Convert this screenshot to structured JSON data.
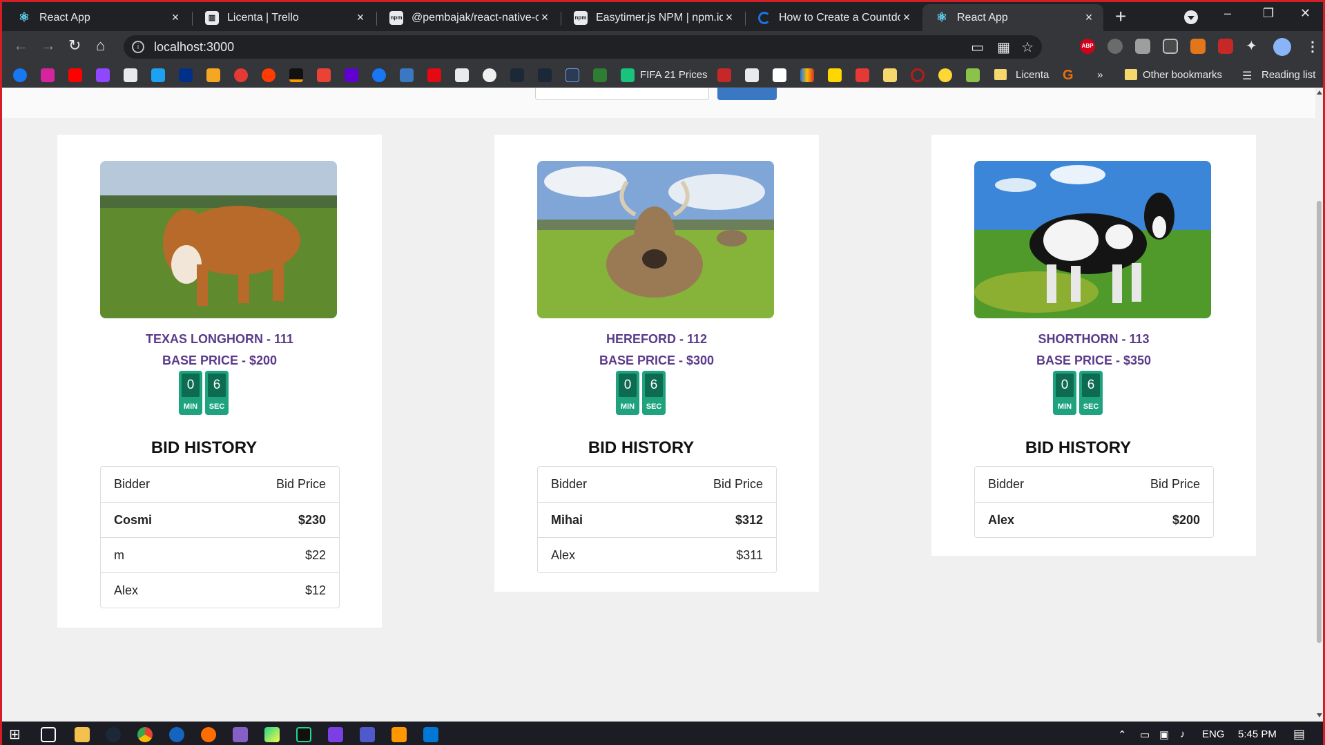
{
  "browser": {
    "tabs": [
      {
        "title": "React App",
        "icon": "react-icon",
        "active": false
      },
      {
        "title": "Licenta | Trello",
        "icon": "trello-icon",
        "active": false
      },
      {
        "title": "@pembajak/react-native-cc",
        "icon": "npm-icon",
        "active": false
      },
      {
        "title": "Easytimer.js NPM | npm.io",
        "icon": "npm-icon",
        "active": false
      },
      {
        "title": "How to Create a Countdow",
        "icon": "loading-icon",
        "active": false
      },
      {
        "title": "React App",
        "icon": "react-icon",
        "active": true
      }
    ],
    "new_tab": "+",
    "window_controls": {
      "minimize": "–",
      "restore": "❐",
      "close": "✕"
    },
    "url": "localhost:3000",
    "nav": {
      "back": "←",
      "forward": "→",
      "reload": "↻",
      "home": "⌂"
    },
    "bookmarks": {
      "fifa_label": "FIFA 21 Prices",
      "licenta_label": "Licenta",
      "more": "»",
      "other_bookmarks": "Other bookmarks",
      "reading_list": "Reading list"
    },
    "extensions": {
      "abp": "ABP"
    }
  },
  "cards": [
    {
      "title": "TEXAS LONGHORN - 111",
      "base_price": "BASE PRICE - $200",
      "timer": {
        "min": "0",
        "sec": "6",
        "min_label": "MIN",
        "sec_label": "SEC"
      },
      "bid_history_title": "BID HISTORY",
      "bid_header": {
        "bidder": "Bidder",
        "price": "Bid Price"
      },
      "bids": [
        {
          "bidder": "Cosmi",
          "price": "$230"
        },
        {
          "bidder": "m",
          "price": "$22"
        },
        {
          "bidder": "Alex",
          "price": "$12"
        }
      ],
      "image_colors": {
        "sky": "#b7c8da",
        "grass": "#5f8a2e",
        "cow": "#b76a2a"
      }
    },
    {
      "title": "HEREFORD - 112",
      "base_price": "BASE PRICE - $300",
      "timer": {
        "min": "0",
        "sec": "6",
        "min_label": "MIN",
        "sec_label": "SEC"
      },
      "bid_history_title": "BID HISTORY",
      "bid_header": {
        "bidder": "Bidder",
        "price": "Bid Price"
      },
      "bids": [
        {
          "bidder": "Mihai",
          "price": "$312"
        },
        {
          "bidder": "Alex",
          "price": "$311"
        }
      ],
      "image_colors": {
        "sky": "#7fa6d6",
        "grass": "#86b43a",
        "cow": "#9a7a55"
      }
    },
    {
      "title": "SHORTHORN - 113",
      "base_price": "BASE PRICE - $350",
      "timer": {
        "min": "0",
        "sec": "6",
        "min_label": "MIN",
        "sec_label": "SEC"
      },
      "bid_history_title": "BID HISTORY",
      "bid_header": {
        "bidder": "Bidder",
        "price": "Bid Price"
      },
      "bids": [
        {
          "bidder": "Alex",
          "price": "$200"
        }
      ],
      "image_colors": {
        "sky": "#3b86d8",
        "grass": "#4f9a2a",
        "cow": "#141414"
      }
    }
  ],
  "taskbar": {
    "language": "ENG",
    "time": "5:45 PM"
  }
}
